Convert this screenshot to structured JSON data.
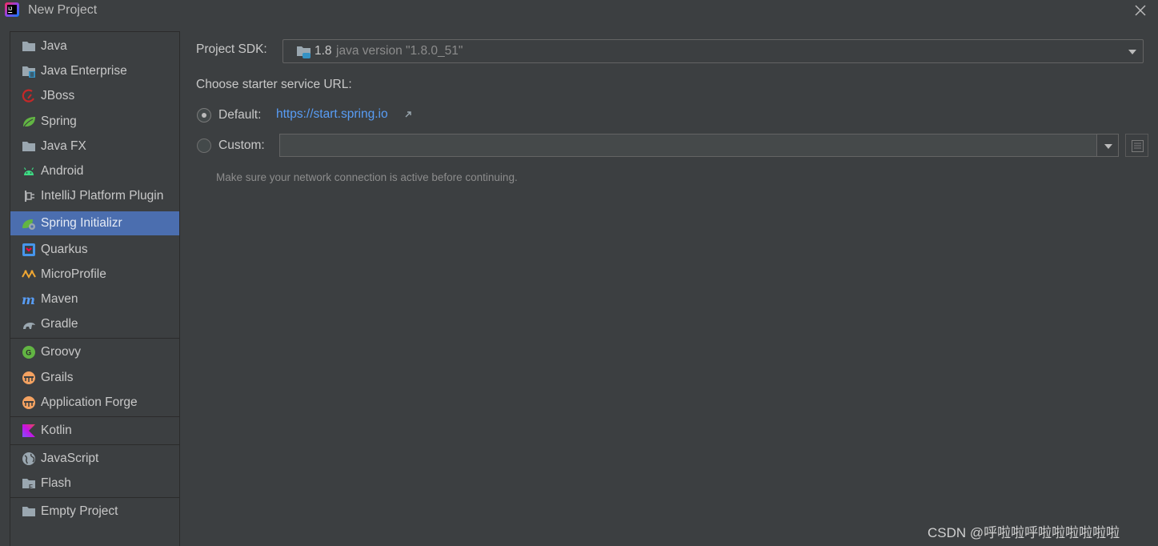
{
  "window": {
    "title": "New Project"
  },
  "sidebar": {
    "items": [
      {
        "label": "Java",
        "icon": "folder-icon"
      },
      {
        "label": "Java Enterprise",
        "icon": "java-enterprise-icon"
      },
      {
        "label": "JBoss",
        "icon": "jboss-icon"
      },
      {
        "label": "Spring",
        "icon": "spring-leaf-icon"
      },
      {
        "label": "Java FX",
        "icon": "folder-icon"
      },
      {
        "label": "Android",
        "icon": "android-icon"
      },
      {
        "label": "IntelliJ Platform Plugin",
        "icon": "plugin-icon"
      },
      {
        "label": "Spring Initializr",
        "icon": "spring-initializr-icon",
        "selected": true
      },
      {
        "label": "Quarkus",
        "icon": "quarkus-icon"
      },
      {
        "label": "MicroProfile",
        "icon": "microprofile-icon"
      },
      {
        "label": "Maven",
        "icon": "maven-icon"
      },
      {
        "label": "Gradle",
        "icon": "gradle-icon"
      },
      {
        "label": "Groovy",
        "icon": "groovy-icon"
      },
      {
        "label": "Grails",
        "icon": "grails-icon"
      },
      {
        "label": "Application Forge",
        "icon": "grails-icon"
      },
      {
        "label": "Kotlin",
        "icon": "kotlin-icon"
      },
      {
        "label": "JavaScript",
        "icon": "globe-icon"
      },
      {
        "label": "Flash",
        "icon": "flash-folder-icon"
      },
      {
        "label": "Empty Project",
        "icon": "folder-icon"
      }
    ]
  },
  "main": {
    "sdk_label": "Project SDK:",
    "sdk_version": "1.8",
    "sdk_detail": "java version \"1.8.0_51\"",
    "starter_label": "Choose starter service URL:",
    "default_label": "Default:",
    "default_url": "https://start.spring.io",
    "default_selected": true,
    "custom_label": "Custom:",
    "custom_value": "",
    "hint": "Make sure your network connection is active before continuing."
  },
  "watermark": "CSDN @呼啦啦呼啦啦啦啦啦啦",
  "colors": {
    "background": "#3c3f41",
    "selection": "#4b6eaf",
    "link": "#589df6",
    "text": "#bbbbbb"
  }
}
